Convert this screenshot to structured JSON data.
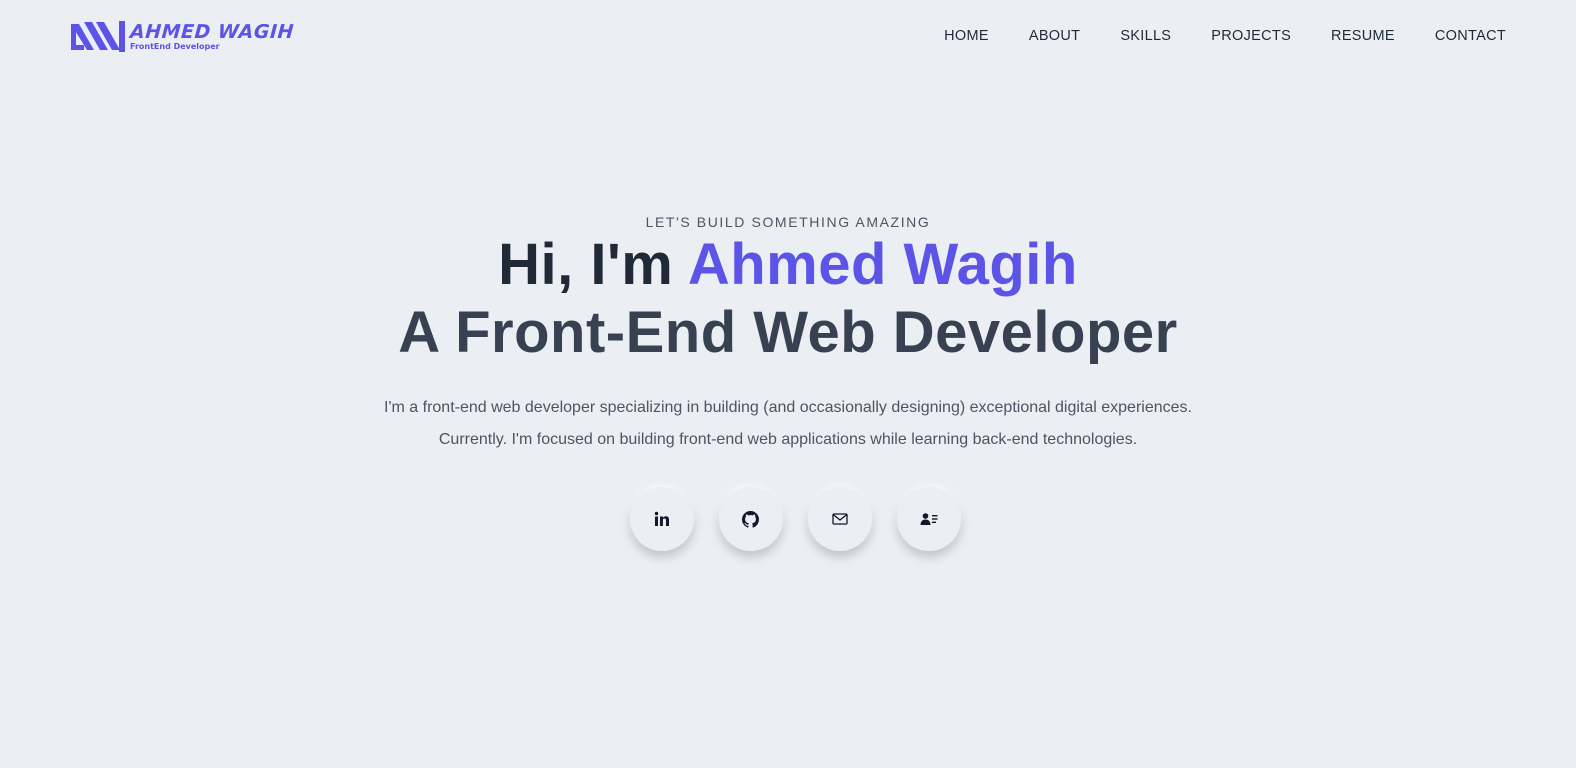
{
  "brand": {
    "name": "AHMED WAGIH",
    "tagline": "FrontEnd Developer",
    "color": "#5b54e6"
  },
  "nav": {
    "items": [
      {
        "label": "HOME"
      },
      {
        "label": "ABOUT"
      },
      {
        "label": "SKILLS"
      },
      {
        "label": "PROJECTS"
      },
      {
        "label": "RESUME"
      },
      {
        "label": "CONTACT"
      }
    ]
  },
  "hero": {
    "eyebrow": "LET'S BUILD SOMETHING AMAZING",
    "greeting": "Hi, I'm ",
    "name": "Ahmed Wagih",
    "role": "A Front-End Web Developer",
    "description_line1": "I'm a front-end web developer specializing in building (and occasionally designing) exceptional digital experiences.",
    "description_line2": "Currently. I'm focused on building front-end web applications while learning back-end technologies."
  },
  "socials": [
    {
      "icon": "linkedin-icon"
    },
    {
      "icon": "github-icon"
    },
    {
      "icon": "mail-icon"
    },
    {
      "icon": "contact-card-icon"
    }
  ],
  "colors": {
    "background": "#ebeff3",
    "accent": "#5b54e6",
    "text_dark": "#1f2937",
    "text_muted": "#4b5563"
  }
}
